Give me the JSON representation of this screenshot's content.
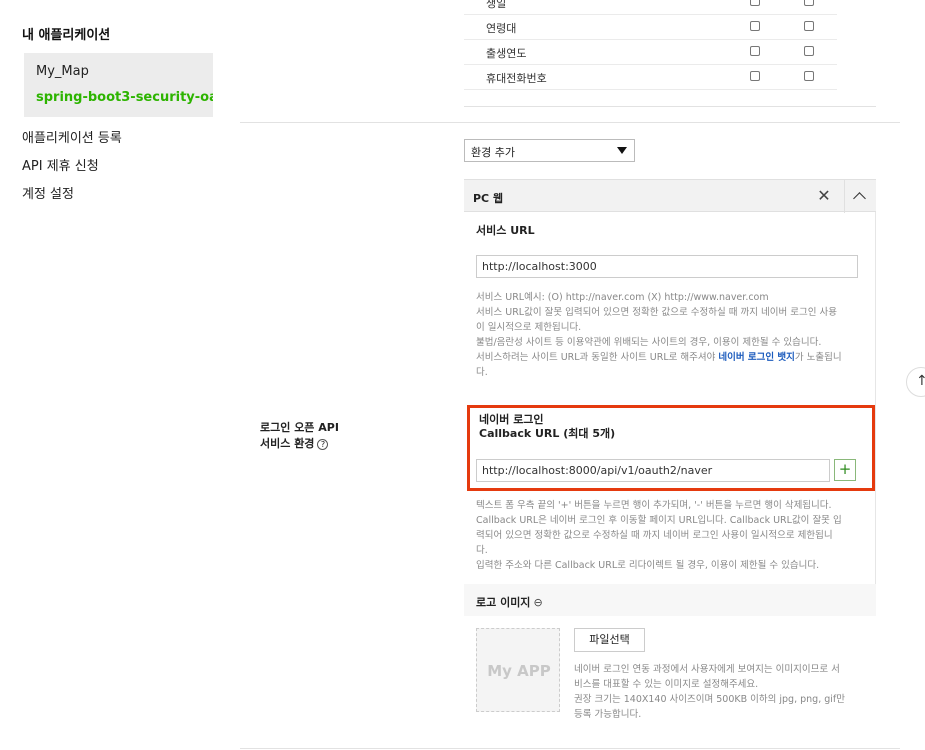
{
  "sidebar": {
    "title": "내 애플리케이션",
    "app_name": "My_Map",
    "app_sub": "spring-boot3-security-oauth",
    "links": [
      "애플리케이션 등록",
      "API 제휴 신청",
      "계정 설정"
    ]
  },
  "scopes": [
    {
      "label": "생일"
    },
    {
      "label": "연령대"
    },
    {
      "label": "출생연도"
    },
    {
      "label": "휴대전화번호"
    }
  ],
  "service_env": {
    "left_label_line1": "로그인 오픈 API",
    "left_label_line2": "서비스 환경",
    "help_symbol": "?",
    "env_select_value": "환경 추가",
    "panel_title": "PC 웹",
    "close_symbol": "✕",
    "service_url": {
      "title": "서비스 URL",
      "value": "http://localhost:3000",
      "help": [
        "서비스 URL예시: (O) http://naver.com (X) http://www.naver.com",
        "서비스 URL값이 잘못 입력되어 있으면 정확한 값으로 수정하실 때 까지 네이버 로그인 사용",
        "이 일시적으로 제한됩니다.",
        "불법/음란성 사이트 등 이용약관에 위배되는 사이트의 경우, 이용이 제한될 수 있습니다.",
        "서비스하려는 사이트 URL과 동일한 사이트 URL로 해주셔야 ",
        "네이버 로그인 뱃지",
        "가 노출됩니",
        "다."
      ]
    },
    "callback": {
      "title_line1": "네이버 로그인",
      "title_line2": "Callback URL (최대 5개)",
      "value": "http://localhost:8000/api/v1/oauth2/naver",
      "plus_symbol": "+",
      "help": [
        "텍스트 폼 우측 끝의 '+' 버튼을 누르면 행이 추가되며, '-' 버튼을 누르면 행이 삭제됩니다.",
        "Callback URL은 네이버 로그인 후 이동할 페이지 URL입니다. Callback URL값이 잘못 입",
        "력되어 있으면 정확한 값으로 수정하실 때 까지 네이버 로그인 사용이 일시적으로 제한됩니",
        "다.",
        "입력한 주소와 다른 Callback URL로 리다이렉트 될 경우, 이용이 제한될 수 있습니다."
      ]
    },
    "logo": {
      "title": "로고 이미지",
      "link_symbol": "⊖",
      "placeholder": "My APP",
      "file_button": "파일선택",
      "help": [
        "네이버 로그인 연동 과정에서 사용자에게 보여지는 이미지이므로 서",
        "비스를 대표할 수 있는 이미지로 설정해주세요.",
        "권장 크기는 140X140 사이즈이며 500KB 이하의 jpg, png, gif만",
        "등록 가능합니다."
      ]
    }
  },
  "scroll_top_symbol": "↑"
}
